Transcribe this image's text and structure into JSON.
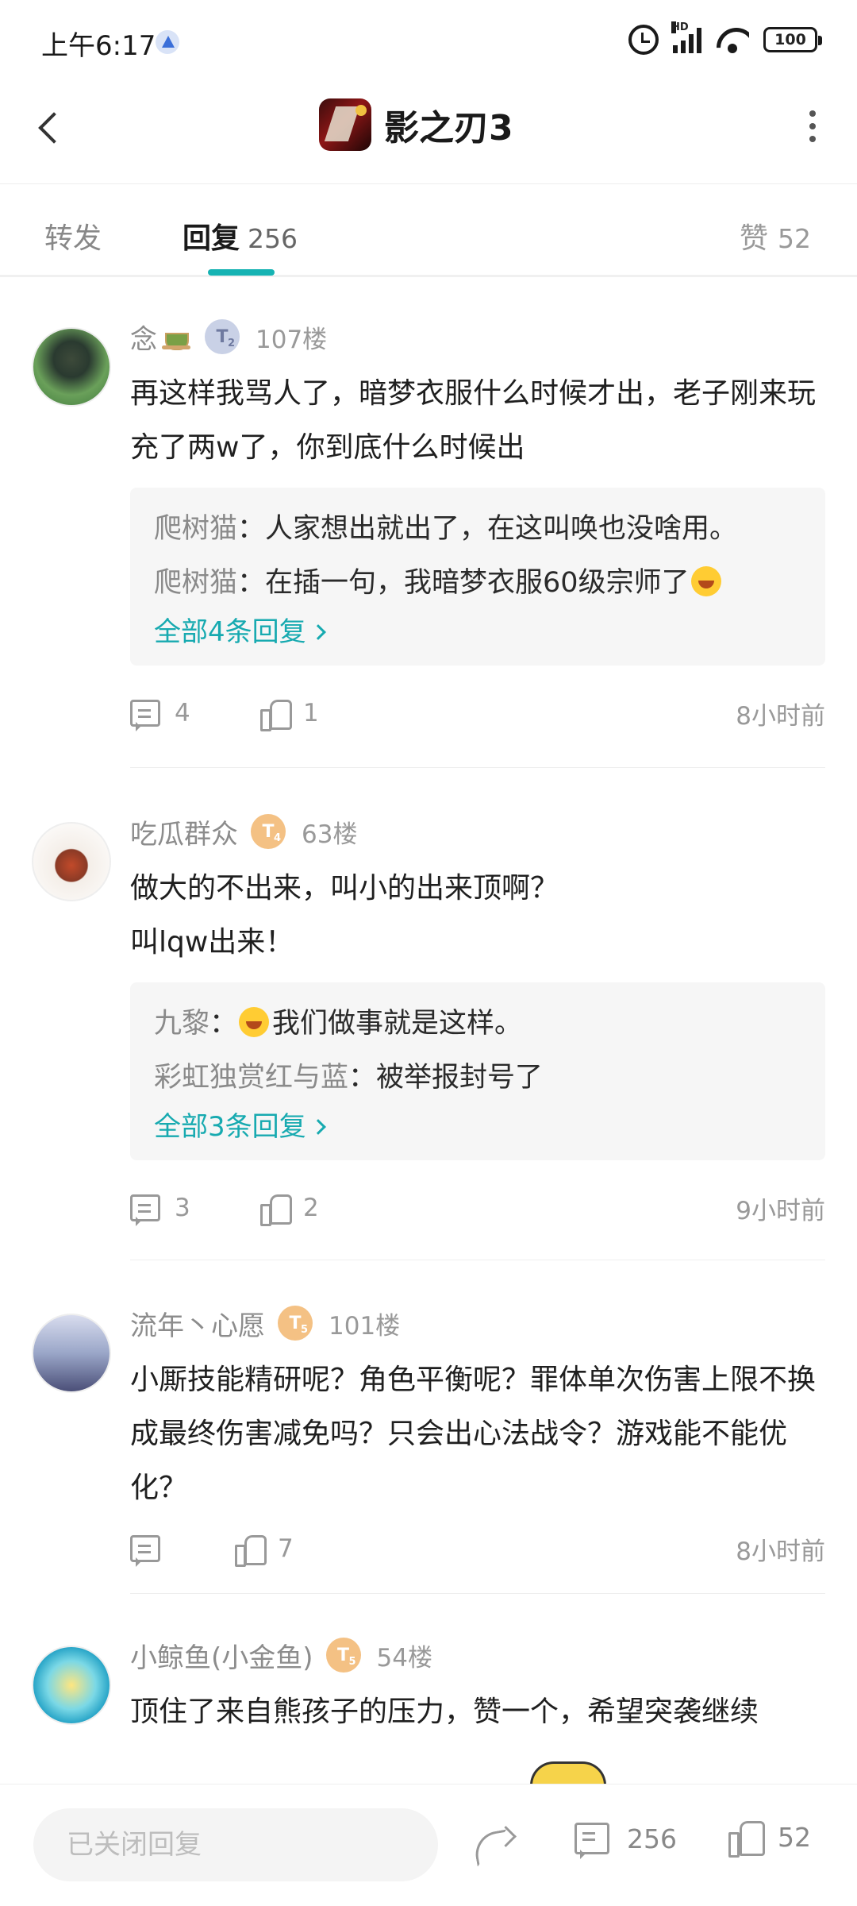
{
  "status_bar": {
    "time": "上午6:17",
    "hd": "HD",
    "battery": "100"
  },
  "header": {
    "title": "影之刃3"
  },
  "tabs": {
    "forward_label": "转发",
    "replies_label": "回复",
    "replies_count": "256",
    "likes_label": "赞",
    "likes_count": "52"
  },
  "comments": [
    {
      "username": "念",
      "badge": "T",
      "badge_level": "2",
      "floor": "107楼",
      "text": "再这样我骂人了，暗梦衣服什么时候才出，老子刚来玩充了两w了，你到底什么时候出",
      "replies": [
        {
          "name": "爬树猫",
          "text": "人家想出就出了，在这叫唤也没啥用。"
        },
        {
          "name": "爬树猫",
          "text": "在插一句，我暗梦衣服60级宗师了"
        }
      ],
      "more_replies": "全部4条回复",
      "comment_count": "4",
      "like_count": "1",
      "time": "8小时前"
    },
    {
      "username": "吃瓜群众",
      "badge": "T",
      "badge_level": "4",
      "floor": "63楼",
      "text_line1": "做大的不出来，叫小的出来顶啊？",
      "text_line2": "叫lqw出来！",
      "replies": [
        {
          "name": "九黎",
          "text": "我们做事就是这样。"
        },
        {
          "name": "彩虹独赏红与蓝",
          "text": "被举报封号了"
        }
      ],
      "more_replies": "全部3条回复",
      "comment_count": "3",
      "like_count": "2",
      "time": "9小时前"
    },
    {
      "username": "流年丶心愿",
      "badge": "T",
      "badge_level": "5",
      "floor": "101楼",
      "text": "小厮技能精研呢？角色平衡呢？罪体单次伤害上限不换成最终伤害减免吗？只会出心法战令？游戏能不能优化？",
      "like_count": "7",
      "time": "8小时前"
    },
    {
      "username": "小鲸鱼(小金鱼)",
      "badge": "T",
      "badge_level": "5",
      "floor": "54楼",
      "text": "顶住了来自熊孩子的压力，赞一个，希望突袭继续"
    }
  ],
  "bottom_bar": {
    "reply_placeholder": "已关闭回复",
    "comment_count": "256",
    "like_count": "52"
  },
  "colors": {
    "accent": "#16b3b3",
    "link": "#17aab0",
    "badge_gold": "#f4c184",
    "badge_silver": "#c9d1e6"
  }
}
